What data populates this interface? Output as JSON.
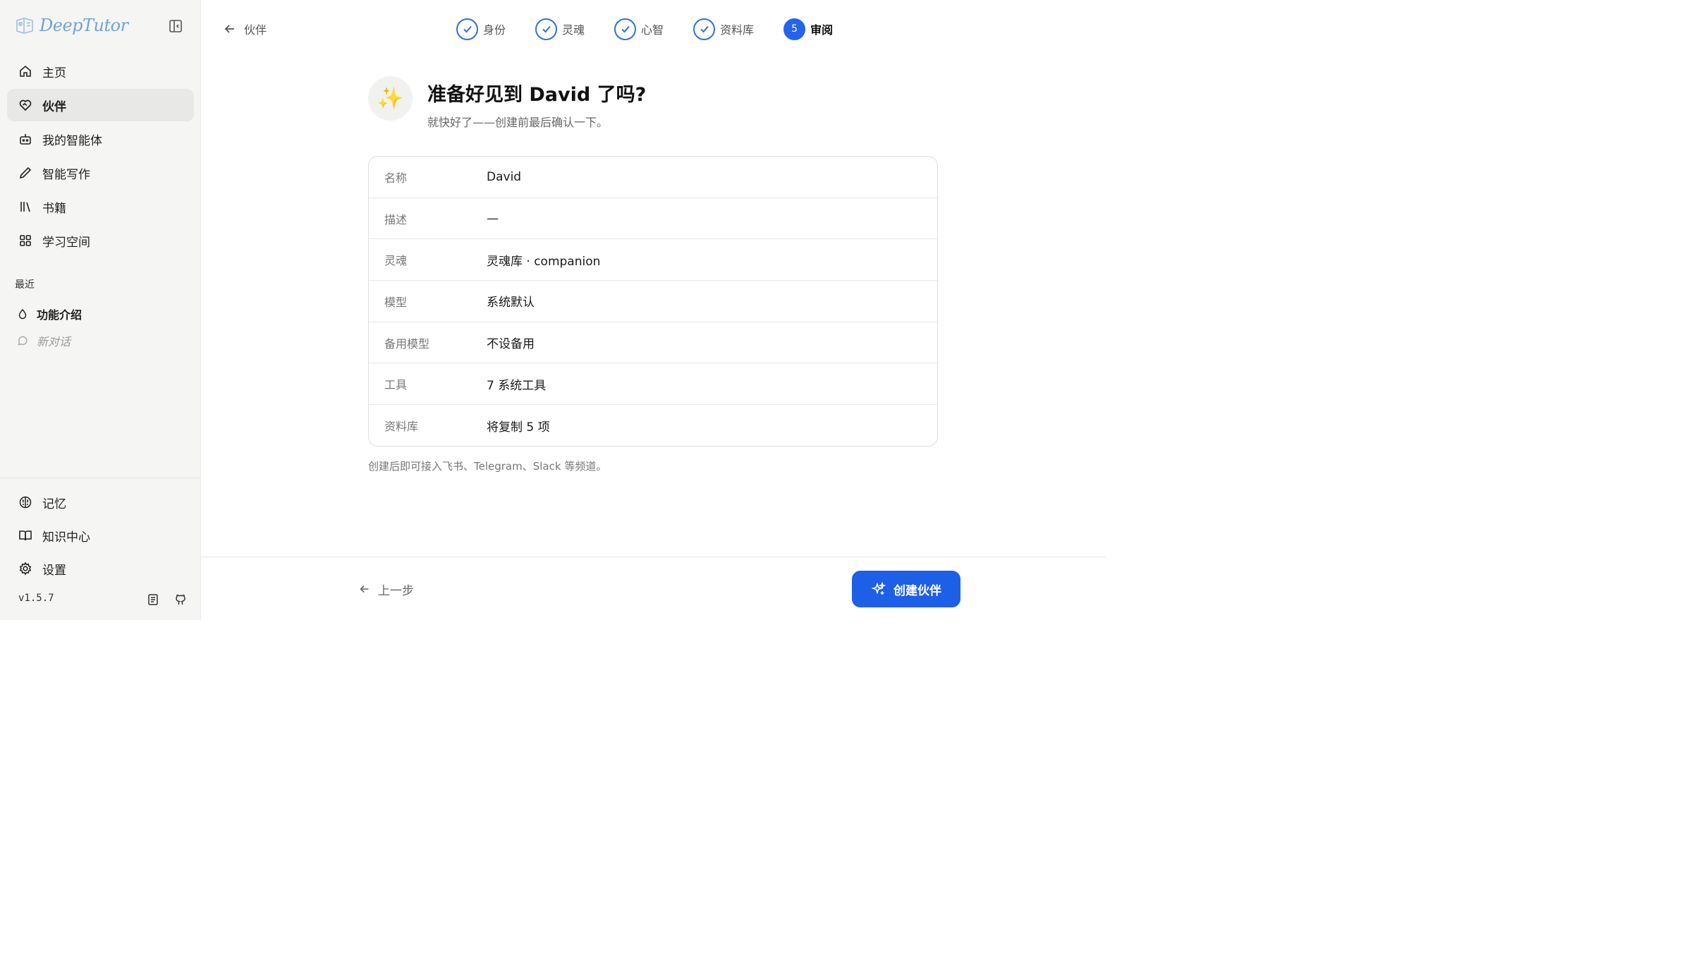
{
  "app": {
    "brand_name": "DeepTutor",
    "version": "v1.5.7"
  },
  "sidebar": {
    "nav": [
      {
        "label": "主页",
        "icon": "home-icon"
      },
      {
        "label": "伙伴",
        "icon": "heart-handshake-icon",
        "active": true
      },
      {
        "label": "我的智能体",
        "icon": "bot-icon"
      },
      {
        "label": "智能写作",
        "icon": "pen-icon"
      },
      {
        "label": "书籍",
        "icon": "library-icon"
      },
      {
        "label": "学习空间",
        "icon": "grid-icon"
      }
    ],
    "recent_label": "最近",
    "recent": [
      {
        "label": "功能介绍",
        "icon": "droplet-icon"
      },
      {
        "label": "新对话",
        "icon": "chat-bubble-icon"
      }
    ],
    "bottom_nav": [
      {
        "label": "记忆",
        "icon": "brain-icon"
      },
      {
        "label": "知识中心",
        "icon": "book-open-icon"
      },
      {
        "label": "设置",
        "icon": "gear-icon"
      }
    ]
  },
  "header": {
    "back_label": "伙伴",
    "steps": [
      {
        "label": "身份",
        "state": "done"
      },
      {
        "label": "灵魂",
        "state": "done"
      },
      {
        "label": "心智",
        "state": "done"
      },
      {
        "label": "资料库",
        "state": "done"
      },
      {
        "label": "审阅",
        "state": "current",
        "number": "5"
      }
    ]
  },
  "main": {
    "hero_icon": "✨",
    "title": "准备好见到 David 了吗?",
    "subtitle": "就快好了——创建前最后确认一下。",
    "review_rows": [
      {
        "label": "名称",
        "value": "David"
      },
      {
        "label": "描述",
        "value": "—"
      },
      {
        "label": "灵魂",
        "value": "灵魂库 · companion"
      },
      {
        "label": "模型",
        "value": "系统默认"
      },
      {
        "label": "备用模型",
        "value": "不设备用"
      },
      {
        "label": "工具",
        "value": "7 系统工具"
      },
      {
        "label": "资料库",
        "value": "将复制 5 项"
      }
    ],
    "note": "创建后即可接入飞书、Telegram、Slack 等频道。"
  },
  "footer": {
    "prev_label": "上一步",
    "create_label": "创建伙伴"
  },
  "colors": {
    "accent": "#1d5fe6",
    "brand": "#6fa3d8"
  }
}
